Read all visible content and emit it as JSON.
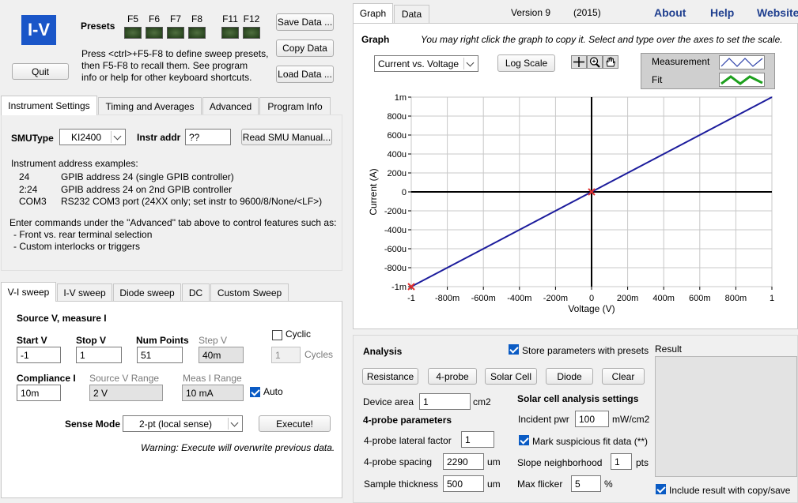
{
  "app": {
    "logo": "I-V",
    "quit_label": "Quit",
    "presets_label": "Presets",
    "preset_keys": [
      "F5",
      "F6",
      "F7",
      "F8",
      "F11",
      "F12"
    ],
    "presets_help": [
      "Press <ctrl>+F5-F8 to define sweep presets,",
      "then F5-F8 to recall them.  See program",
      "info or help for other keyboard shortcuts."
    ],
    "save_data_label": "Save Data ...",
    "copy_data_label": "Copy Data",
    "load_data_label": "Load Data ..."
  },
  "top_tabs": {
    "items": [
      "Instrument Settings",
      "Timing and Averages",
      "Advanced",
      "Program Info"
    ],
    "active": "Instrument Settings"
  },
  "instrument": {
    "smu_type_label": "SMUType",
    "smu_type_value": "KI2400",
    "instr_addr_label": "Instr addr",
    "instr_addr_value": "??",
    "read_manual_label": "Read SMU Manual...",
    "examples_title": "Instrument address examples:",
    "examples": [
      {
        "addr": "24",
        "desc": "GPIB address 24 (single GPIB controller)"
      },
      {
        "addr": "2:24",
        "desc": "GPIB address 24 on 2nd GPIB controller"
      },
      {
        "addr": "COM3",
        "desc": "RS232 COM3 port (24XX only; set instr to 9600/8/None/<LF>)"
      }
    ],
    "advanced_note": "Enter commands under the \"Advanced\" tab above to control features such as:",
    "advanced_bullets": [
      "- Front vs. rear terminal selection",
      "- Custom interlocks or triggers"
    ]
  },
  "sweep_tabs": {
    "items": [
      "V-I sweep",
      "I-V sweep",
      "Diode sweep",
      "DC",
      "Custom Sweep"
    ],
    "active": "V-I sweep"
  },
  "sweep": {
    "heading": "Source V, measure I",
    "start_v_label": "Start V",
    "start_v_value": "-1",
    "stop_v_label": "Stop V",
    "stop_v_value": "1",
    "num_points_label": "Num Points",
    "num_points_value": "51",
    "step_v_label": "Step V",
    "step_v_value": "40m",
    "cyclic_label": "Cyclic",
    "cyclic_checked": false,
    "cycles_value": "1",
    "cycles_label": "Cycles",
    "compliance_label": "Compliance I",
    "compliance_value": "10m",
    "source_range_label": "Source V Range",
    "source_range_value": "2 V",
    "meas_range_label": "Meas I Range",
    "meas_range_value": "10 mA",
    "auto_label": "Auto",
    "auto_checked": true,
    "sense_mode_label": "Sense Mode",
    "sense_mode_value": "2-pt (local sense)",
    "execute_label": "Execute!",
    "warning": "Warning: Execute will overwrite previous data."
  },
  "right_tabs": {
    "items": [
      "Graph",
      "Data"
    ],
    "active": "Graph"
  },
  "header": {
    "version": "Version 9",
    "year": "(2015)",
    "links": [
      "About",
      "Help",
      "Website"
    ]
  },
  "graph": {
    "label": "Graph",
    "hint": "You may right click the graph to copy it.  Select and type over the axes to set the scale.",
    "mode_value": "Current vs. Voltage",
    "log_scale_label": "Log Scale",
    "legend": [
      {
        "name": "Measurement",
        "color": "#2b3fa8"
      },
      {
        "name": "Fit",
        "color": "#1ea01e"
      }
    ]
  },
  "chart_data": {
    "type": "line",
    "xlabel": "Voltage (V)",
    "ylabel": "Current (A)",
    "xlim": [
      -1,
      1
    ],
    "ylim": [
      -0.001,
      0.001
    ],
    "x_ticks": [
      {
        "v": -1,
        "label": "-1"
      },
      {
        "v": -0.8,
        "label": "-800m"
      },
      {
        "v": -0.6,
        "label": "-600m"
      },
      {
        "v": -0.4,
        "label": "-400m"
      },
      {
        "v": -0.2,
        "label": "-200m"
      },
      {
        "v": 0,
        "label": "0"
      },
      {
        "v": 0.2,
        "label": "200m"
      },
      {
        "v": 0.4,
        "label": "400m"
      },
      {
        "v": 0.6,
        "label": "600m"
      },
      {
        "v": 0.8,
        "label": "800m"
      },
      {
        "v": 1,
        "label": "1"
      }
    ],
    "y_ticks": [
      {
        "v": 0.001,
        "label": "1m"
      },
      {
        "v": 0.0008,
        "label": "800u"
      },
      {
        "v": 0.0006,
        "label": "600u"
      },
      {
        "v": 0.0004,
        "label": "400u"
      },
      {
        "v": 0.0002,
        "label": "200u"
      },
      {
        "v": 0,
        "label": "0"
      },
      {
        "v": -0.0002,
        "label": "-200u"
      },
      {
        "v": -0.0004,
        "label": "-400u"
      },
      {
        "v": -0.0006,
        "label": "-600u"
      },
      {
        "v": -0.0008,
        "label": "-800u"
      },
      {
        "v": -0.001,
        "label": "-1m"
      }
    ],
    "grid": true,
    "series": [
      {
        "name": "Measurement",
        "x": [
          -1,
          1
        ],
        "y": [
          -0.001,
          0.001
        ],
        "color": "#1c1c9c"
      }
    ],
    "markers": [
      {
        "x": -1,
        "y": -0.001,
        "color": "#e03030"
      },
      {
        "x": 0,
        "y": 0,
        "color": "#e03030"
      }
    ]
  },
  "analysis": {
    "heading": "Analysis",
    "store_label": "Store parameters with presets",
    "store_checked": true,
    "buttons": [
      "Resistance",
      "4-probe",
      "Solar Cell",
      "Diode",
      "Clear"
    ],
    "result_label": "Result",
    "device_area_label": "Device area",
    "device_area_value": "1",
    "device_area_unit": "cm2",
    "four_probe_heading": "4-probe parameters",
    "lateral_label": "4-probe lateral factor",
    "lateral_value": "1",
    "spacing_label": "4-probe spacing",
    "spacing_value": "2290",
    "spacing_unit": "um",
    "thickness_label": "Sample thickness",
    "thickness_value": "500",
    "thickness_unit": "um",
    "solar_heading": "Solar cell analysis settings",
    "incident_label": "Incident pwr",
    "incident_value": "100",
    "incident_unit": "mW/cm2",
    "suspicious_label": "Mark suspicious fit data (**)",
    "suspicious_checked": true,
    "slope_label": "Slope neighborhood",
    "slope_value": "1",
    "slope_unit": "pts",
    "flicker_label": "Max flicker",
    "flicker_value": "5",
    "flicker_unit": "%",
    "include_label": "Include result with copy/save",
    "include_checked": true
  }
}
